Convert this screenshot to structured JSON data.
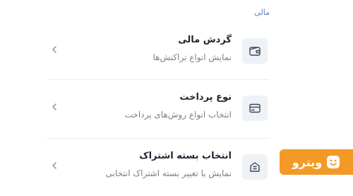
{
  "section": {
    "title": "مالی"
  },
  "items": [
    {
      "title": "گردش مالی",
      "subtitle": "نمایش انواع تراکنش‌ها",
      "icon": "wallet-icon"
    },
    {
      "title": "نوع پرداخت",
      "subtitle": "انتخاب انواع روش‌های پرداخت",
      "icon": "card-icon"
    },
    {
      "title": "انتخاب بسته اشتراک",
      "subtitle": "نمایش یا تغییر بسته اشتراک انتخابی",
      "icon": "package-icon"
    }
  ],
  "brand": {
    "name": "ویترو",
    "color": "#f39a26",
    "icon": "smile-logo-icon"
  },
  "colors": {
    "section_title": "#5b7fb8",
    "icon_bg": "#eef2f6",
    "icon_stroke": "#3d4656"
  }
}
